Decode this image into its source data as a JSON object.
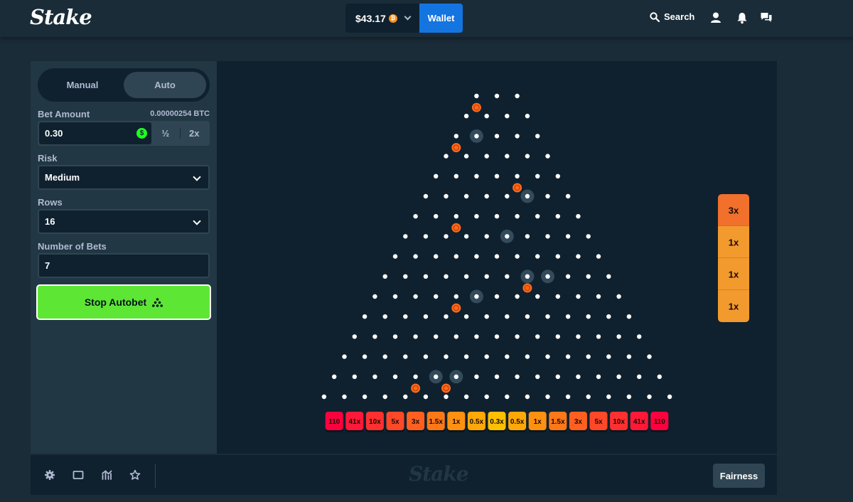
{
  "header": {
    "logo": "Stake",
    "balance": "$43.17",
    "currency_icon": "bitcoin-icon",
    "wallet_label": "Wallet",
    "search_label": "Search",
    "icons": [
      "user-icon",
      "bell-icon",
      "chat-icon"
    ]
  },
  "controls": {
    "tabs": [
      {
        "label": "Manual",
        "active": false
      },
      {
        "label": "Auto",
        "active": true
      }
    ],
    "bet_amount_label": "Bet Amount",
    "bet_amount_btc": "0.00000254 BTC",
    "bet_amount_value": "0.30",
    "half_label": "½",
    "double_label": "2x",
    "risk_label": "Risk",
    "risk_value": "Medium",
    "rows_label": "Rows",
    "rows_value": "16",
    "bets_label": "Number of Bets",
    "bets_value": "7",
    "stop_label": "Stop Autobet"
  },
  "game": {
    "rows": 16,
    "multipliers": [
      "110",
      "41x",
      "10x",
      "5x",
      "3x",
      "1.5x",
      "1x",
      "0.5x",
      "0.3x",
      "0.5x",
      "1x",
      "1.5x",
      "3x",
      "5x",
      "10x",
      "41x",
      "110"
    ],
    "bucket_colors": [
      "#ff003f",
      "#ff1837",
      "#ff302f",
      "#ff4827",
      "#ff6020",
      "#ff7818",
      "#ff9010",
      "#ffa808",
      "#ffc000",
      "#ffa808",
      "#ff9010",
      "#ff7818",
      "#ff6020",
      "#ff4827",
      "#ff302f",
      "#ff1837",
      "#ff003f"
    ],
    "history": [
      {
        "label": "3x",
        "color": "#f0702c"
      },
      {
        "label": "1x",
        "color": "#f29a2e"
      },
      {
        "label": "1x",
        "color": "#f29a2e"
      },
      {
        "label": "1x",
        "color": "#f29a2e"
      }
    ],
    "balls": [
      [
        1,
        0.5
      ],
      [
        3,
        0.5
      ],
      [
        5,
        4.5
      ],
      [
        7,
        2.5
      ],
      [
        10,
        7.5
      ],
      [
        11,
        4.5
      ],
      [
        15,
        4.5
      ],
      [
        15,
        6
      ]
    ],
    "glows": [
      [
        2,
        1
      ],
      [
        5,
        5
      ],
      [
        7,
        5
      ],
      [
        9,
        7
      ],
      [
        10,
        5
      ],
      [
        9,
        8
      ],
      [
        14,
        5
      ],
      [
        14,
        6
      ]
    ]
  },
  "footer": {
    "icons": [
      "settings-icon",
      "theatre-mode-icon",
      "stats-icon",
      "favourite-icon"
    ],
    "logo": "Stake",
    "fairness_label": "Fairness"
  }
}
